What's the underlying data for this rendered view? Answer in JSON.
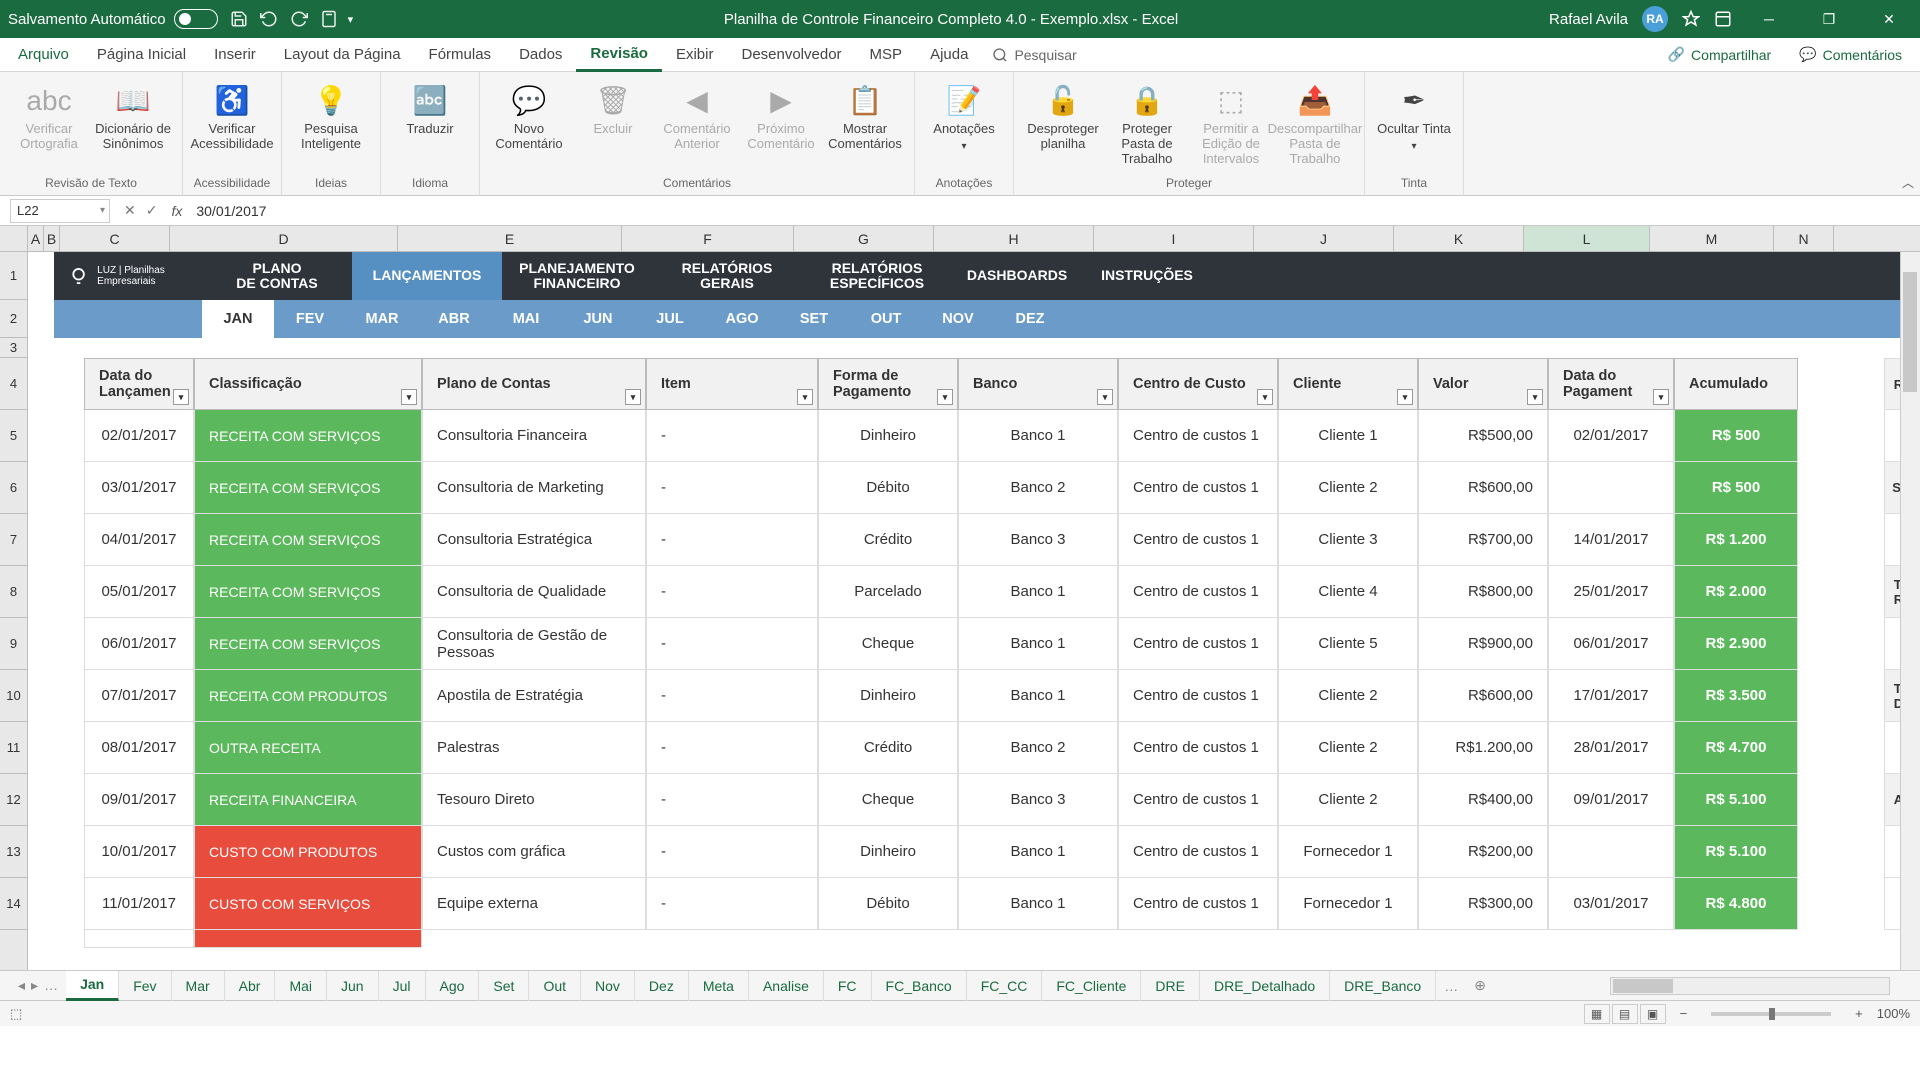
{
  "title": "Planilha de Controle Financeiro Completo 4.0 - Exemplo.xlsx  -  Excel",
  "autosave_label": "Salvamento Automático",
  "user_name": "Rafael Avila",
  "user_initials": "RA",
  "menus": {
    "file": "Arquivo",
    "home": "Página Inicial",
    "insert": "Inserir",
    "layout": "Layout da Página",
    "formulas": "Fórmulas",
    "data": "Dados",
    "review": "Revisão",
    "view": "Exibir",
    "dev": "Desenvolvedor",
    "msp": "MSP",
    "help": "Ajuda",
    "search": "Pesquisar",
    "share": "Compartilhar",
    "comments": "Comentários"
  },
  "ribbon": {
    "g1": {
      "label": "Revisão de Texto",
      "b1": "Verificar Ortografia",
      "b2": "Dicionário de Sinônimos"
    },
    "g2": {
      "label": "Acessibilidade",
      "b1": "Verificar Acessibilidade"
    },
    "g3": {
      "label": "Ideias",
      "b1": "Pesquisa Inteligente"
    },
    "g4": {
      "label": "Idioma",
      "b1": "Traduzir"
    },
    "g5": {
      "label": "Comentários",
      "b1": "Novo Comentário",
      "b2": "Excluir",
      "b3": "Comentário Anterior",
      "b4": "Próximo Comentário",
      "b5": "Mostrar Comentários"
    },
    "g6": {
      "label": "Anotações",
      "b1": "Anotações"
    },
    "g7": {
      "label": "Proteger",
      "b1": "Desproteger planilha",
      "b2": "Proteger Pasta de Trabalho",
      "b3": "Permitir a Edição de Intervalos",
      "b4": "Descompartilhar Pasta de Trabalho"
    },
    "g8": {
      "label": "Tinta",
      "b1": "Ocultar Tinta"
    }
  },
  "cell_ref": "L22",
  "formula_value": "30/01/2017",
  "cols": [
    "A",
    "B",
    "C",
    "D",
    "E",
    "F",
    "G",
    "H",
    "I",
    "J",
    "K",
    "L",
    "M",
    "N"
  ],
  "logo_text": "LUZ | Planilhas Empresariais",
  "nav1": [
    "PLANO DE CONTAS",
    "LANÇAMENTOS",
    "PLANEJAMENTO FINANCEIRO",
    "RELATÓRIOS GERAIS",
    "RELATÓRIOS ESPECÍFICOS",
    "DASHBOARDS",
    "INSTRUÇÕES"
  ],
  "months": [
    "JAN",
    "FEV",
    "MAR",
    "ABR",
    "MAI",
    "JUN",
    "JUL",
    "AGO",
    "SET",
    "OUT",
    "NOV",
    "DEZ"
  ],
  "headers": [
    "Data do Lançamen",
    "Classificação",
    "Plano de Contas",
    "Item",
    "Forma de Pagamento",
    "Banco",
    "Centro de Custo",
    "Cliente",
    "Valor",
    "Data do Pagament",
    "Acumulado",
    "Re"
  ],
  "side": [
    "",
    "Sal",
    "",
    "To Re",
    "",
    "To De",
    "",
    "Ac"
  ],
  "rows": [
    {
      "d": "02/01/2017",
      "cl": "RECEITA COM SERVIÇOS",
      "pc": "Consultoria Financeira",
      "it": "-",
      "fp": "Dinheiro",
      "bn": "Banco 1",
      "cc": "Centro de custos 1",
      "cli": "Cliente 1",
      "v": "R$500,00",
      "dp": "02/01/2017",
      "ac": "R$ 500",
      "g": 1
    },
    {
      "d": "03/01/2017",
      "cl": "RECEITA COM SERVIÇOS",
      "pc": "Consultoria de Marketing",
      "it": "-",
      "fp": "Débito",
      "bn": "Banco 2",
      "cc": "Centro de custos 1",
      "cli": "Cliente 2",
      "v": "R$600,00",
      "dp": "",
      "ac": "R$ 500",
      "g": 1
    },
    {
      "d": "04/01/2017",
      "cl": "RECEITA COM SERVIÇOS",
      "pc": "Consultoria Estratégica",
      "it": "-",
      "fp": "Crédito",
      "bn": "Banco 3",
      "cc": "Centro de custos 1",
      "cli": "Cliente 3",
      "v": "R$700,00",
      "dp": "14/01/2017",
      "ac": "R$ 1.200",
      "g": 1
    },
    {
      "d": "05/01/2017",
      "cl": "RECEITA COM SERVIÇOS",
      "pc": "Consultoria de Qualidade",
      "it": "-",
      "fp": "Parcelado",
      "bn": "Banco 1",
      "cc": "Centro de custos 1",
      "cli": "Cliente 4",
      "v": "R$800,00",
      "dp": "25/01/2017",
      "ac": "R$ 2.000",
      "g": 1
    },
    {
      "d": "06/01/2017",
      "cl": "RECEITA COM SERVIÇOS",
      "pc": "Consultoria de Gestão de Pessoas",
      "it": "-",
      "fp": "Cheque",
      "bn": "Banco 1",
      "cc": "Centro de custos 1",
      "cli": "Cliente 5",
      "v": "R$900,00",
      "dp": "06/01/2017",
      "ac": "R$ 2.900",
      "g": 1
    },
    {
      "d": "07/01/2017",
      "cl": "RECEITA COM PRODUTOS",
      "pc": "Apostila de Estratégia",
      "it": "-",
      "fp": "Dinheiro",
      "bn": "Banco 1",
      "cc": "Centro de custos 1",
      "cli": "Cliente 2",
      "v": "R$600,00",
      "dp": "17/01/2017",
      "ac": "R$ 3.500",
      "g": 1
    },
    {
      "d": "08/01/2017",
      "cl": "OUTRA RECEITA",
      "pc": "Palestras",
      "it": "-",
      "fp": "Crédito",
      "bn": "Banco 2",
      "cc": "Centro de custos 1",
      "cli": "Cliente 2",
      "v": "R$1.200,00",
      "dp": "28/01/2017",
      "ac": "R$ 4.700",
      "g": 1
    },
    {
      "d": "09/01/2017",
      "cl": "RECEITA FINANCEIRA",
      "pc": "Tesouro Direto",
      "it": "-",
      "fp": "Cheque",
      "bn": "Banco 3",
      "cc": "Centro de custos 1",
      "cli": "Cliente 2",
      "v": "R$400,00",
      "dp": "09/01/2017",
      "ac": "R$ 5.100",
      "g": 1
    },
    {
      "d": "10/01/2017",
      "cl": "CUSTO COM PRODUTOS",
      "pc": "Custos com gráfica",
      "it": "-",
      "fp": "Dinheiro",
      "bn": "Banco 1",
      "cc": "Centro de custos 1",
      "cli": "Fornecedor 1",
      "v": "R$200,00",
      "dp": "",
      "ac": "R$ 5.100",
      "g": 0
    },
    {
      "d": "11/01/2017",
      "cl": "CUSTO COM SERVIÇOS",
      "pc": "Equipe externa",
      "it": "-",
      "fp": "Débito",
      "bn": "Banco 1",
      "cc": "Centro de custos 1",
      "cli": "Fornecedor 1",
      "v": "R$300,00",
      "dp": "03/01/2017",
      "ac": "R$ 4.800",
      "g": 0
    }
  ],
  "sheets": [
    "Jan",
    "Fev",
    "Mar",
    "Abr",
    "Mai",
    "Jun",
    "Jul",
    "Ago",
    "Set",
    "Out",
    "Nov",
    "Dez",
    "Meta",
    "Analise",
    "FC",
    "FC_Banco",
    "FC_CC",
    "FC_Cliente",
    "DRE",
    "DRE_Detalhado",
    "DRE_Banco"
  ],
  "zoom": "100%"
}
